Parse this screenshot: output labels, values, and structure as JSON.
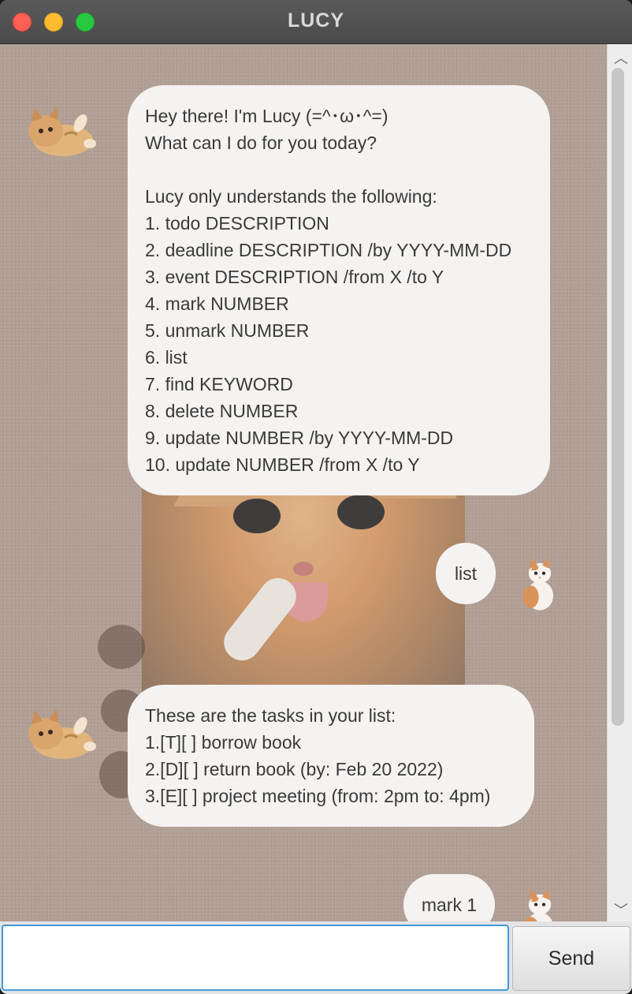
{
  "window": {
    "title": "LUCY"
  },
  "messages": [
    {
      "sender": "bot",
      "text": "Hey there! I'm Lucy (=^･ω･^=)\nWhat can I do for you today?\n\nLucy only understands the following:\n1. todo DESCRIPTION\n2. deadline DESCRIPTION /by YYYY-MM-DD\n3. event DESCRIPTION /from X /to Y\n4. mark NUMBER\n5. unmark NUMBER\n6. list\n7. find KEYWORD\n8. delete NUMBER\n9. update NUMBER /by YYYY-MM-DD\n10. update NUMBER /from X /to Y"
    },
    {
      "sender": "user",
      "text": "list"
    },
    {
      "sender": "bot",
      "text": "These are the tasks in your list:\n1.[T][ ] borrow book\n2.[D][ ] return book (by: Feb 20 2022)\n3.[E][ ] project meeting (from: 2pm to: 4pm)"
    },
    {
      "sender": "user",
      "text": "mark 1"
    }
  ],
  "input": {
    "value": "",
    "placeholder": ""
  },
  "send_button": {
    "label": "Send"
  },
  "colors": {
    "chat_background": "#b19f95",
    "bubble": "#f5f3f1",
    "input_focus": "#3d9bd9"
  },
  "icons": {
    "bot_avatar": "lying-kitten-icon",
    "user_avatar": "sitting-kitten-icon"
  }
}
